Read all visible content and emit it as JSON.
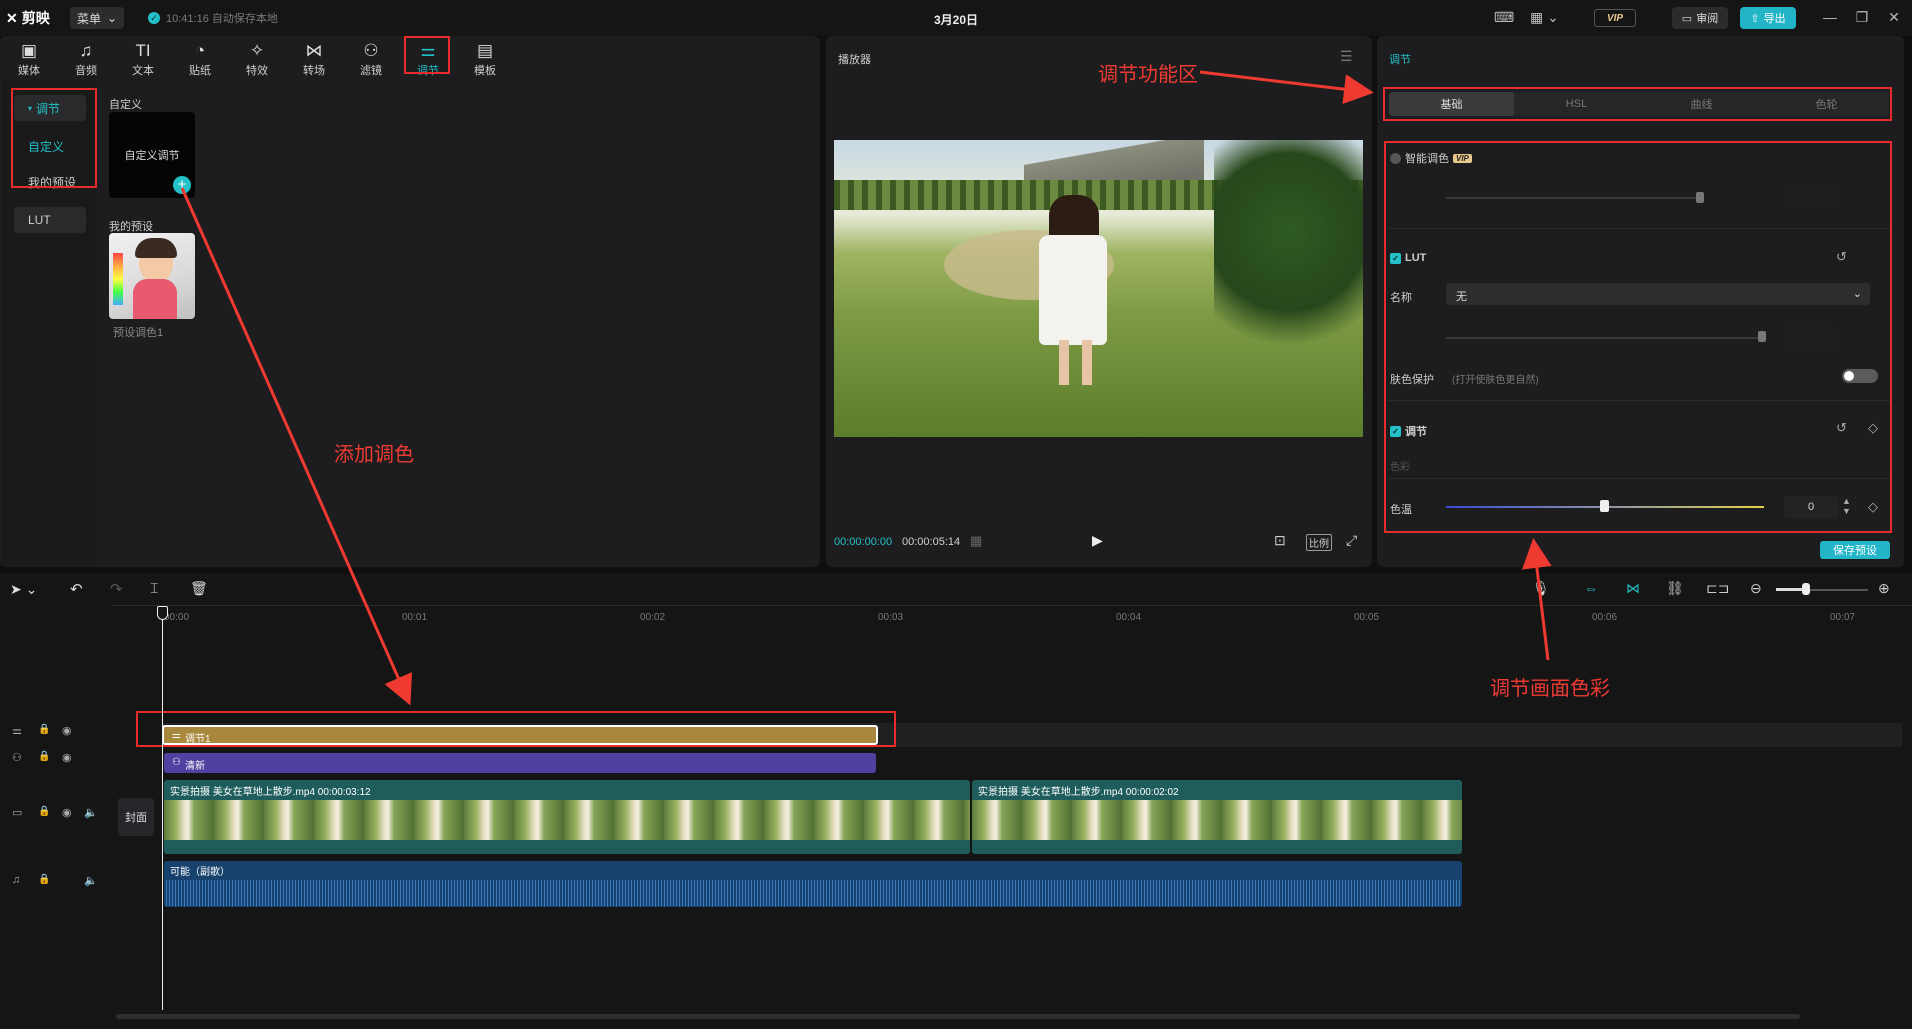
{
  "app": {
    "name": "剪映",
    "menu_label": "菜单",
    "autosave": "10:41:16 自动保存本地",
    "project_title": "3月20日",
    "vip": "VIP",
    "review": "审阅",
    "export": "导出"
  },
  "toolbar": [
    {
      "label": "媒体",
      "icon": "media-icon",
      "glyph": "▣"
    },
    {
      "label": "音频",
      "icon": "audio-icon",
      "glyph": "♫"
    },
    {
      "label": "文本",
      "icon": "text-icon",
      "glyph": "TI"
    },
    {
      "label": "贴纸",
      "icon": "sticker-icon",
      "glyph": "◔"
    },
    {
      "label": "特效",
      "icon": "effects-icon",
      "glyph": "✧"
    },
    {
      "label": "转场",
      "icon": "transition-icon",
      "glyph": "⋈"
    },
    {
      "label": "滤镜",
      "icon": "filter-icon",
      "glyph": "⚇"
    },
    {
      "label": "调节",
      "icon": "adjust-icon",
      "glyph": "⚌"
    },
    {
      "label": "模板",
      "icon": "template-icon",
      "glyph": "▤"
    }
  ],
  "sidebar": {
    "items": [
      "调节",
      "自定义",
      "我的预设",
      "LUT"
    ]
  },
  "library": {
    "custom_heading": "自定义",
    "custom_card": "自定义调节",
    "preset_heading": "我的预设",
    "preset_name": "预设调色1"
  },
  "player": {
    "title": "播放器",
    "current_time": "00:00:00:00",
    "total_time": "00:00:05:14",
    "ratio": "比例"
  },
  "adjust": {
    "title": "调节",
    "tabs": [
      "基础",
      "HSL",
      "曲线",
      "色轮"
    ],
    "smart_color": "智能调色",
    "smart_vip": "VIP",
    "lut_label": "LUT",
    "name_label": "名称",
    "name_value": "无",
    "skin_label": "肤色保护",
    "skin_hint": "(打开使肤色更自然)",
    "adjust_label": "调节",
    "color_label": "色彩",
    "temp_label": "色温",
    "temp_value": "0",
    "save_preset": "保存预设"
  },
  "annotations": {
    "func_area": "调节功能区",
    "add_color": "添加调色",
    "adjust_color": "调节画面色彩"
  },
  "timeline": {
    "ticks": [
      "00:00",
      "00:01",
      "00:02",
      "00:03",
      "00:04",
      "00:05",
      "00:06",
      "00:07"
    ],
    "cover": "封面",
    "adjust_clip": "调节1",
    "filter_clip": "清新",
    "video_clip_1": "实景拍摄 美女在草地上散步.mp4  00:00:03:12",
    "video_clip_2": "实景拍摄 美女在草地上散步.mp4  00:00:02:02",
    "audio_clip": "可能（副歌）"
  }
}
